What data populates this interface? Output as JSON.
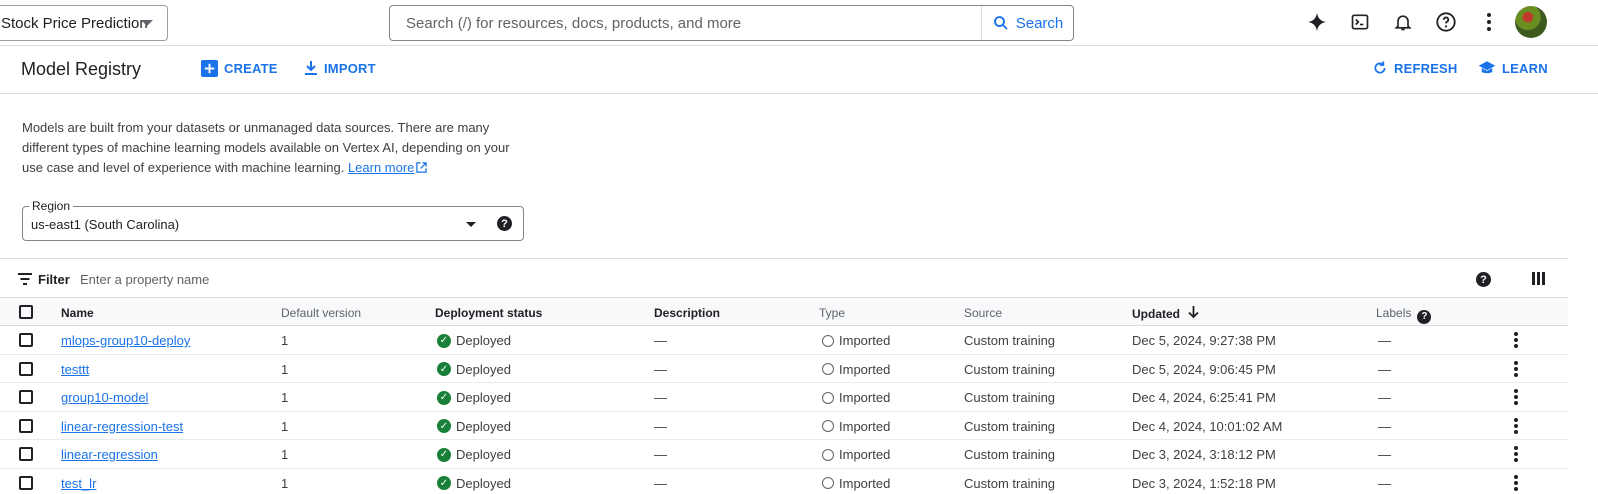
{
  "topbar": {
    "project": "Stock Price Prediction",
    "search_placeholder": "Search (/) for resources, docs, products, and more",
    "search_button": "Search",
    "icons": [
      "gemini-sparkle-icon",
      "cloud-shell-icon",
      "notifications-icon",
      "help-icon",
      "more-vert-icon"
    ]
  },
  "header": {
    "title": "Model Registry",
    "create": "CREATE",
    "import": "IMPORT",
    "refresh": "REFRESH",
    "learn": "LEARN"
  },
  "intro": {
    "text": "Models are built from your datasets or unmanaged data sources. There are many different types of machine learning models available on Vertex AI, depending on your use case and level of experience with machine learning.",
    "link": "Learn more"
  },
  "region": {
    "label": "Region",
    "value": "us-east1 (South Carolina)"
  },
  "filter": {
    "label": "Filter",
    "placeholder": "Enter a property name"
  },
  "table": {
    "columns": {
      "name": "Name",
      "default_version": "Default version",
      "deployment_status": "Deployment status",
      "description": "Description",
      "type": "Type",
      "source": "Source",
      "updated": "Updated",
      "labels": "Labels"
    },
    "rows": [
      {
        "name": "mlops-group10-deploy",
        "version": "1",
        "status": "Deployed",
        "description": "—",
        "type": "Imported",
        "source": "Custom training",
        "updated": "Dec 5, 2024, 9:27:38 PM",
        "labels": "—"
      },
      {
        "name": "testtt",
        "version": "1",
        "status": "Deployed",
        "description": "—",
        "type": "Imported",
        "source": "Custom training",
        "updated": "Dec 5, 2024, 9:06:45 PM",
        "labels": "—"
      },
      {
        "name": "group10-model",
        "version": "1",
        "status": "Deployed",
        "description": "—",
        "type": "Imported",
        "source": "Custom training",
        "updated": "Dec 4, 2024, 6:25:41 PM",
        "labels": "—"
      },
      {
        "name": "linear-regression-test",
        "version": "1",
        "status": "Deployed",
        "description": "—",
        "type": "Imported",
        "source": "Custom training",
        "updated": "Dec 4, 2024, 10:01:02 AM",
        "labels": "—"
      },
      {
        "name": "linear-regression",
        "version": "1",
        "status": "Deployed",
        "description": "—",
        "type": "Imported",
        "source": "Custom training",
        "updated": "Dec 3, 2024, 3:18:12 PM",
        "labels": "—"
      },
      {
        "name": "test_lr",
        "version": "1",
        "status": "Deployed",
        "description": "—",
        "type": "Imported",
        "source": "Custom training",
        "updated": "Dec 3, 2024, 1:52:18 PM",
        "labels": "—"
      }
    ]
  }
}
